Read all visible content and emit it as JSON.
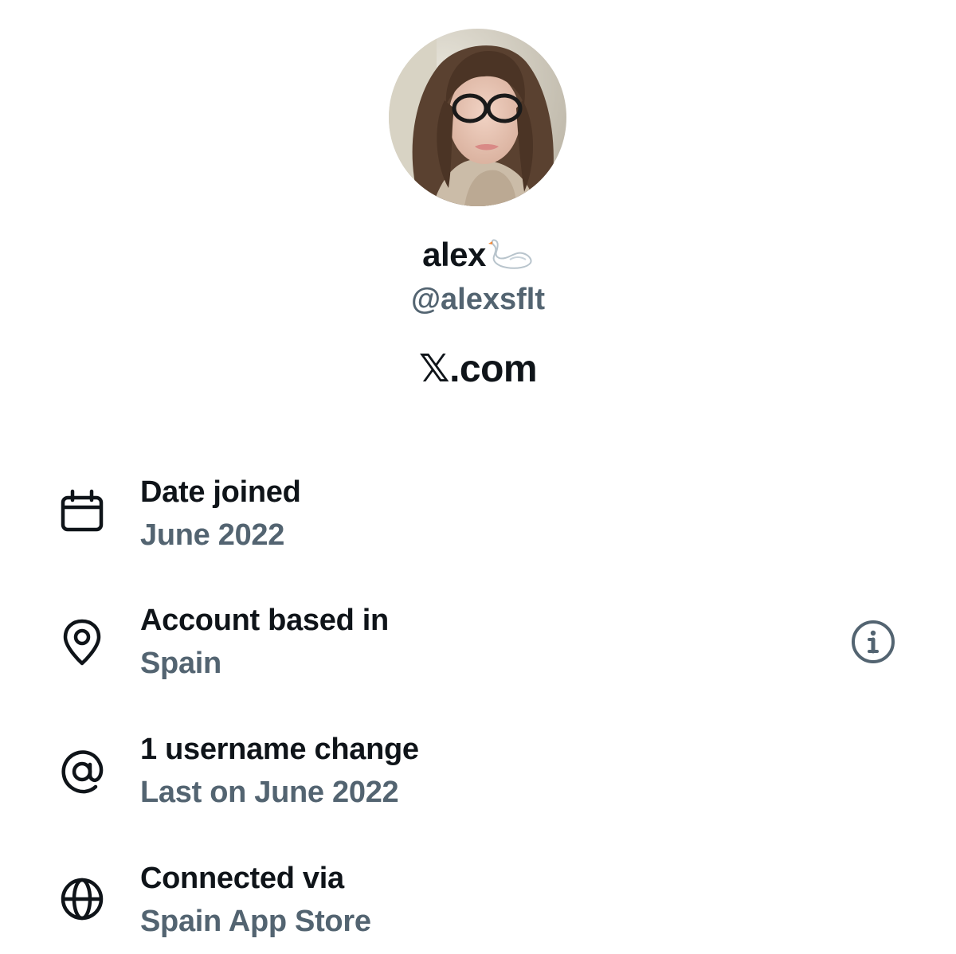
{
  "profile": {
    "display_name": "alex",
    "name_emoji": "swan-emoji",
    "handle": "@alexsflt",
    "site": "𝕏.com"
  },
  "details": [
    {
      "icon": "calendar-icon",
      "title": "Date joined",
      "value": "June 2022"
    },
    {
      "icon": "location-pin-icon",
      "title": "Account based in",
      "value": "Spain"
    },
    {
      "icon": "at-sign-icon",
      "title": "1 username change",
      "value": "Last on June 2022"
    },
    {
      "icon": "globe-icon",
      "title": "Connected via",
      "value": "Spain App Store"
    }
  ],
  "colors": {
    "primary_text": "#0f1419",
    "secondary_text": "#536471",
    "background": "#ffffff"
  }
}
